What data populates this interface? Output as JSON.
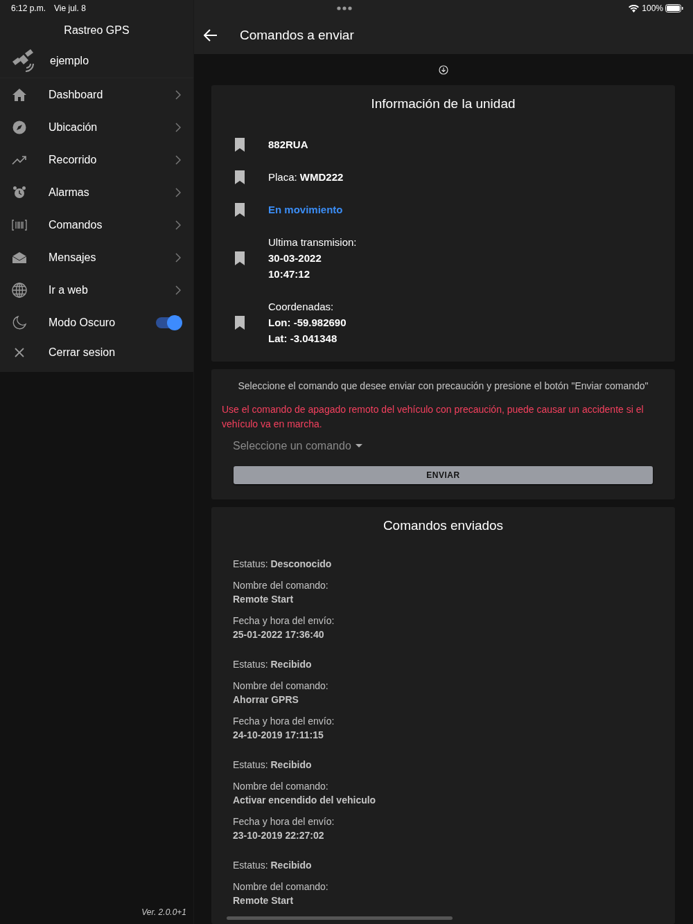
{
  "status_bar": {
    "time": "6:12 p.m.",
    "date": "Vie jul. 8",
    "battery": "100%"
  },
  "sidebar": {
    "title": "Rastreo GPS",
    "user": "ejemplo",
    "items": [
      {
        "kind": "nav",
        "label": "Dashboard"
      },
      {
        "kind": "nav",
        "label": "Ubicación"
      },
      {
        "kind": "nav",
        "label": "Recorrido"
      },
      {
        "kind": "nav",
        "label": "Alarmas"
      },
      {
        "kind": "nav",
        "label": "Comandos"
      },
      {
        "kind": "nav",
        "label": "Mensajes"
      },
      {
        "kind": "nav",
        "label": "Ir a web"
      },
      {
        "kind": "toggle",
        "label": "Modo Oscuro",
        "on": true
      },
      {
        "kind": "action",
        "label": "Cerrar sesion"
      }
    ],
    "version": "Ver. 2.0.0+1"
  },
  "app_bar": {
    "title": "Comandos a enviar"
  },
  "unit_info": {
    "title": "Información de la unidad",
    "rows": [
      {
        "kind": "plain",
        "lines": [
          "**882RUA**"
        ]
      },
      {
        "kind": "plain",
        "lines": [
          "Placa: **WMD222**"
        ]
      },
      {
        "kind": "status",
        "lines": [
          "En movimiento"
        ]
      },
      {
        "kind": "plain",
        "lines": [
          "Ultima transmision:",
          "**30-03-2022**",
          "**10:47:12**"
        ]
      },
      {
        "kind": "plain",
        "lines": [
          "Coordenadas:",
          "**Lon: -59.982690**",
          "**Lat: -3.041348**"
        ]
      }
    ]
  },
  "send_form": {
    "instruction": "Seleccione el comando que desee enviar con precaución y presione el botón \"Enviar comando\"",
    "warning": "Use el comando de apagado remoto del vehículo con precaución, puede causar un accidente si el vehículo va en marcha.",
    "select": {
      "placeholder": "Seleccione un comando"
    },
    "button": "ENVIAR"
  },
  "sent_commands": {
    "title": "Comandos enviados",
    "items": [
      {
        "status_label": "Estatus:",
        "status": "Desconocido",
        "name_label": "Nombre del comando:",
        "name": "Remote Start",
        "date_label": "Fecha y hora del envío:",
        "date": "25-01-2022 17:36:40"
      },
      {
        "status_label": "Estatus:",
        "status": "Recibido",
        "name_label": "Nombre del comando:",
        "name": "Ahorrar GPRS",
        "date_label": "Fecha y hora del envío:",
        "date": "24-10-2019 17:11:15"
      },
      {
        "status_label": "Estatus:",
        "status": "Recibido",
        "name_label": "Nombre del comando:",
        "name": "Activar encendido del vehiculo",
        "date_label": "Fecha y hora del envío:",
        "date": "23-10-2019 22:27:02"
      },
      {
        "status_label": "Estatus:",
        "status": "Recibido",
        "name_label": "Nombre del comando:",
        "name": "Remote Start"
      }
    ]
  }
}
